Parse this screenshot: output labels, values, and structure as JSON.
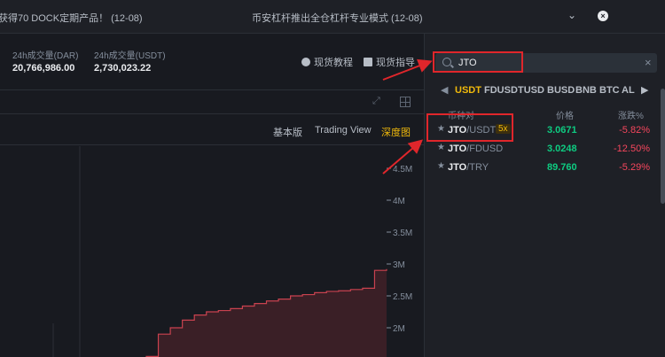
{
  "announcements": {
    "item1": "获得70 DOCK定期产品！ (12-08)",
    "item2": "币安杠杆推出全仓杠杆专业模式 (12-08)"
  },
  "stats": {
    "vol_base_label": "24h成交量(DAR)",
    "vol_base_value": "20,766,986.00",
    "vol_quote_label": "24h成交量(USDT)",
    "vol_quote_value": "2,730,023.22"
  },
  "tools": {
    "tutorial": "现货教程",
    "guide": "现货指导"
  },
  "view_tabs": {
    "basic": "基本版",
    "tradingview": "Trading View",
    "depth": "深度图"
  },
  "search": {
    "value": "JTO"
  },
  "quote_tabs": [
    "USDT",
    "FDUSD",
    "TUSD",
    "BUSD",
    "BNB",
    "BTC",
    "AL"
  ],
  "active_quote_tab": "USDT",
  "columns": {
    "pair": "币种对",
    "price": "价格",
    "change": "涨跌%"
  },
  "markets": [
    {
      "base": "JTO",
      "quote": "/USDT",
      "leverage": "5x",
      "price": "3.0671",
      "change": "-5.82%"
    },
    {
      "base": "JTO",
      "quote": "/FDUSD",
      "leverage": "",
      "price": "3.0248",
      "change": "-12.50%"
    },
    {
      "base": "JTO",
      "quote": "/TRY",
      "leverage": "",
      "price": "89.760",
      "change": "-5.29%"
    }
  ],
  "colors": {
    "accent": "#f0b90b",
    "up": "#0ecb81",
    "down": "#f6465d",
    "annotation": "#e0262b"
  },
  "chart_data": {
    "type": "area",
    "y_ticks": [
      "4.5M",
      "4M",
      "3.5M",
      "3M",
      "2.5M",
      "2M"
    ],
    "ylim": [
      1.5,
      5.0
    ],
    "x": [
      0,
      1,
      2,
      3,
      4,
      5,
      6,
      7,
      8,
      9,
      10,
      11,
      12,
      13,
      14,
      15,
      16,
      17,
      18,
      19,
      20
    ],
    "values": [
      1.55,
      1.9,
      2.0,
      2.12,
      2.2,
      2.25,
      2.27,
      2.3,
      2.34,
      2.38,
      2.42,
      2.45,
      2.5,
      2.52,
      2.55,
      2.57,
      2.58,
      2.6,
      2.62,
      2.9,
      2.92
    ]
  }
}
